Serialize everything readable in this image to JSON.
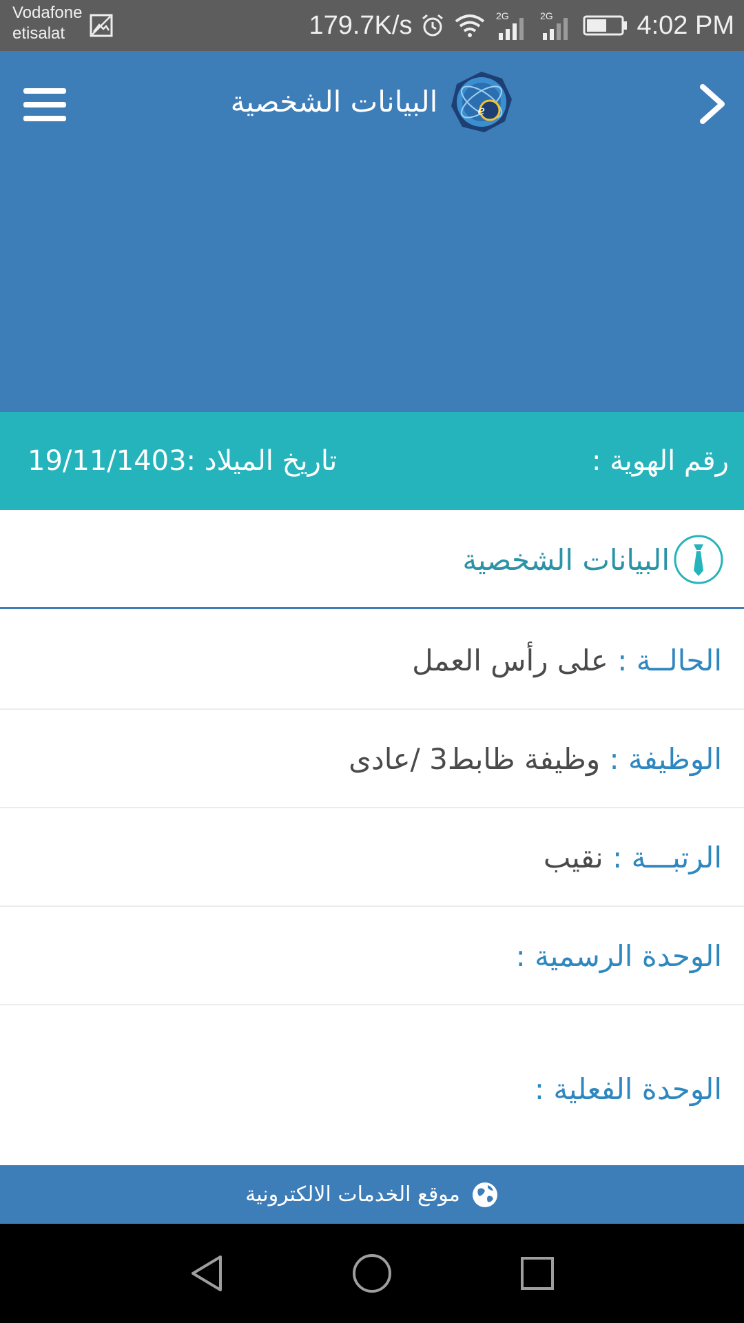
{
  "status_bar": {
    "carrier_line1": "Vodafone",
    "carrier_line2": "etisalat",
    "speed": "179.7K/s",
    "network1": "2G",
    "network2": "2G",
    "time": "4:02 PM"
  },
  "app_bar": {
    "title": "البيانات الشخصية",
    "menu_icon": "hamburger-menu-icon",
    "back_icon": "chevron-right-icon",
    "logo_icon": "globe-e-logo-icon",
    "background": "#3d7db8"
  },
  "info_strip": {
    "id_label": "رقم الهوية :",
    "birth_label": "تاريخ الميلاد :",
    "birth_value": "19/11/1403",
    "background": "#25b4bc"
  },
  "section": {
    "title": "البيانات الشخصية",
    "icon": "tie-icon"
  },
  "rows": [
    {
      "label": "الحالــة :",
      "value": "على رأس العمل"
    },
    {
      "label": "الوظيفة :",
      "value": "وظيفة ظابط3 /عادى"
    },
    {
      "label": "الرتبـــة :",
      "value": "نقيب"
    },
    {
      "label": "الوحدة الرسمية :",
      "value": ""
    },
    {
      "label": "الوحدة الفعلية :",
      "value": ""
    }
  ],
  "footer": {
    "link_text": "موقع الخدمات الالكترونية",
    "icon": "globe-icon"
  },
  "nav_bar": {
    "back": "triangle-back-icon",
    "home": "circle-home-icon",
    "recent": "square-recent-icon"
  },
  "colors": {
    "label_blue": "#2f87c0",
    "section_teal": "#2a93a6",
    "value_gray": "#4a4a4a"
  }
}
